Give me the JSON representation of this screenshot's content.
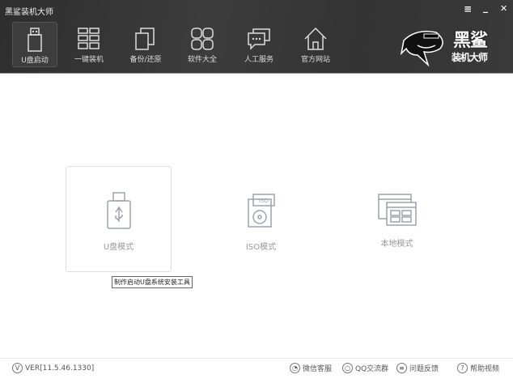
{
  "app": {
    "title": "黑鲨装机大师",
    "menu_icon": "≡",
    "minimize_icon": "_",
    "close_icon": "✕"
  },
  "nav": [
    {
      "label": "U盘启动",
      "icon": "usb-icon",
      "active": true
    },
    {
      "label": "一键装机",
      "icon": "windows-icon"
    },
    {
      "label": "备份/还原",
      "icon": "copy-icon"
    },
    {
      "label": "软件大全",
      "icon": "apps-icon"
    },
    {
      "label": "人工服务",
      "icon": "chat-icon"
    },
    {
      "label": "官方网站",
      "icon": "home-icon"
    }
  ],
  "logo": {
    "text1": "黑鲨",
    "text2": "装机大师"
  },
  "modes": [
    {
      "label": "U盘模式"
    },
    {
      "label": "ISO模式",
      "badge": "ISO"
    },
    {
      "label": "本地模式"
    }
  ],
  "tooltip": "制作启动U盘系统安装工具",
  "footer": {
    "version": "VER[11.5.46.1330]",
    "version_icon": "V",
    "links": [
      {
        "label": "微信客服"
      },
      {
        "label": "QQ交流群"
      },
      {
        "label": "问题反馈"
      },
      {
        "label": "帮助视频",
        "icon": "?"
      }
    ]
  }
}
